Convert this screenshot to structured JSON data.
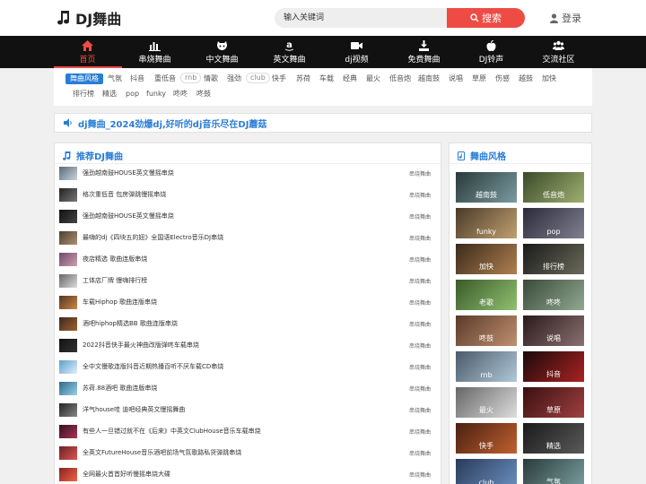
{
  "brand": {
    "name": "DJ舞曲",
    "icon": "music-note-icon"
  },
  "search": {
    "placeholder": "输入关键词",
    "button_label": "搜索"
  },
  "login": {
    "label": "登录",
    "icon": "user-icon"
  },
  "nav": [
    {
      "label": "首页",
      "icon": "home-icon",
      "active": true
    },
    {
      "label": "串烧舞曲",
      "icon": "bar-chart-icon",
      "active": false
    },
    {
      "label": "中文舞曲",
      "icon": "github-cat-icon",
      "active": false
    },
    {
      "label": "英文舞曲",
      "icon": "amazon-icon",
      "active": false
    },
    {
      "label": "dj视频",
      "icon": "video-camera-icon",
      "active": false
    },
    {
      "label": "免费舞曲",
      "icon": "download-icon",
      "active": false
    },
    {
      "label": "DJ铃声",
      "icon": "apple-icon",
      "active": false
    },
    {
      "label": "交流社区",
      "icon": "users-icon",
      "active": false
    }
  ],
  "tags_row1": [
    "舞曲风格",
    "气氛",
    "抖音",
    "重低音",
    "rnb",
    "情歌",
    "强劲",
    "club",
    "快手",
    "苏荷",
    "车载",
    "经典",
    "最火",
    "低音炮",
    "越南鼓",
    "说唱",
    "草原",
    "伤感",
    "越鼓",
    "加快"
  ],
  "tags_row2": [
    "排行榜",
    "精选",
    "pop",
    "funky",
    "咚咚",
    "咚鼓"
  ],
  "notice": {
    "text": "dj舞曲_2024劲爆dj,好听的dj音乐尽在DJ蘑菇",
    "icon": "volume-icon"
  },
  "recommend": {
    "title": "推荐DJ舞曲",
    "icon": "music-note-icon",
    "songs": [
      {
        "name": "强劲越南鼓HOUSE英文慢摇串烧",
        "category": "串烧舞曲"
      },
      {
        "name": "格次重低音 包房弹跳慢摇串烧",
        "category": "串烧舞曲"
      },
      {
        "name": "强劲越南鼓HOUSE英文慢摇串烧",
        "category": "串烧舞曲"
      },
      {
        "name": "最嗨的dj《四块五的妞》全国语Electro音乐DJ串烧",
        "category": "串烧舞曲"
      },
      {
        "name": "夜店精选 歌曲连版串烧",
        "category": "串烧舞曲"
      },
      {
        "name": "工体店厂牌 慢嗨排行榜",
        "category": "串烧舞曲"
      },
      {
        "name": "车载Hiphop 歌曲连版串烧",
        "category": "串烧舞曲"
      },
      {
        "name": "酒吧hiphop精选BB 歌曲连版串烧",
        "category": "串烧舞曲"
      },
      {
        "name": "2022抖音快手最火神曲改版弹咚车载串烧",
        "category": "串烧舞曲"
      },
      {
        "name": "全中文慢歌连版抖音近期热播百听不厌车载CD串烧",
        "category": "串烧舞曲"
      },
      {
        "name": "苏荷.88酒吧 歌曲连版串烧",
        "category": "串烧舞曲"
      },
      {
        "name": "洋气house哇 迪吧经典英文慢摇舞曲",
        "category": "串烧舞曲"
      },
      {
        "name": "有些人一旦错过就不在《后来》中英文ClubHouse音乐车载串烧",
        "category": "串烧舞曲"
      },
      {
        "name": "全英文FutureHouse音乐酒吧前场气氛歌路私货弹跳串烧",
        "category": "串烧舞曲"
      },
      {
        "name": "全网最火首首好听慢摇串烧大碟",
        "category": "串烧舞曲"
      }
    ]
  },
  "styles": {
    "title": "舞曲风格",
    "icon": "file-music-icon",
    "items": [
      "越南鼓",
      "低音炮",
      "funky",
      "pop",
      "加快",
      "排行榜",
      "老歌",
      "咚咚",
      "咚鼓",
      "说唱",
      "rnb",
      "抖音",
      "最火",
      "草原",
      "快手",
      "精选",
      "club",
      "气氛"
    ]
  },
  "colors": {
    "accent": "#ef4b45",
    "link": "#2a7dd6",
    "nav_bg": "#111111"
  }
}
